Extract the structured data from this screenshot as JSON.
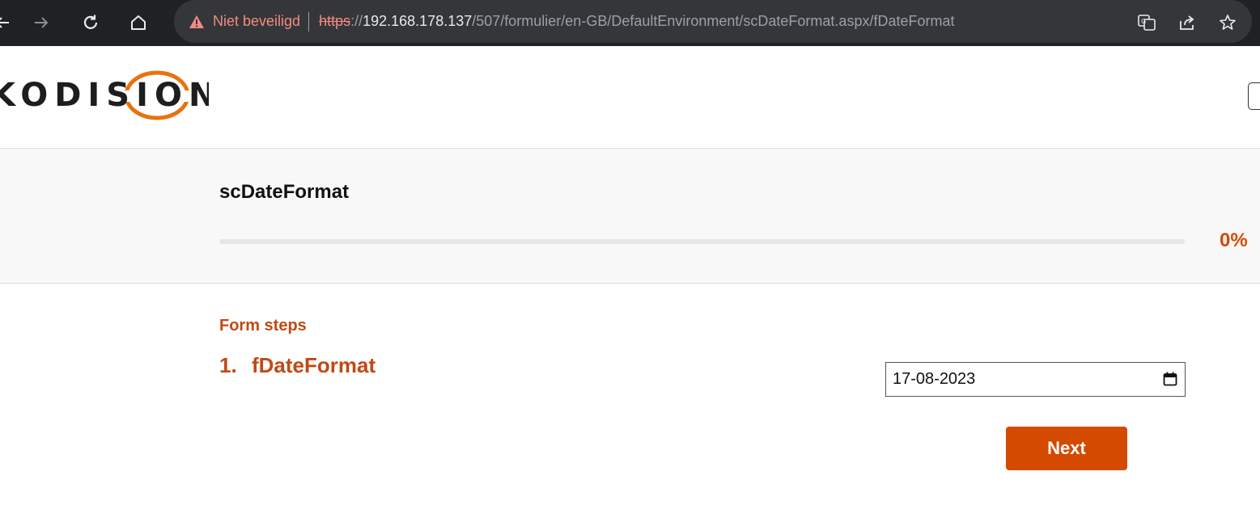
{
  "browser": {
    "security_label": "Niet beveiligd",
    "url": {
      "scheme": "https",
      "separator": "://",
      "host": "192.168.178.137",
      "path": "/507/formulier/en-GB/DefaultEnvironment/scDateFormat.aspx/fDateFormat"
    },
    "icons": [
      "back-icon",
      "forward-icon",
      "reload-icon",
      "home-icon",
      "warning-icon",
      "translate-icon",
      "share-icon",
      "bookmark-star-icon"
    ]
  },
  "header": {
    "logo_text": "KODISION",
    "brand_color": "#d44a00"
  },
  "form": {
    "title": "scDateFormat",
    "progress_percent": 0,
    "progress_label": "0%"
  },
  "steps": {
    "heading": "Form steps",
    "items": [
      {
        "number": "1.",
        "label": "fDateFormat"
      }
    ]
  },
  "date_field": {
    "value": "17-08-2023"
  },
  "actions": {
    "next_label": "Next"
  }
}
